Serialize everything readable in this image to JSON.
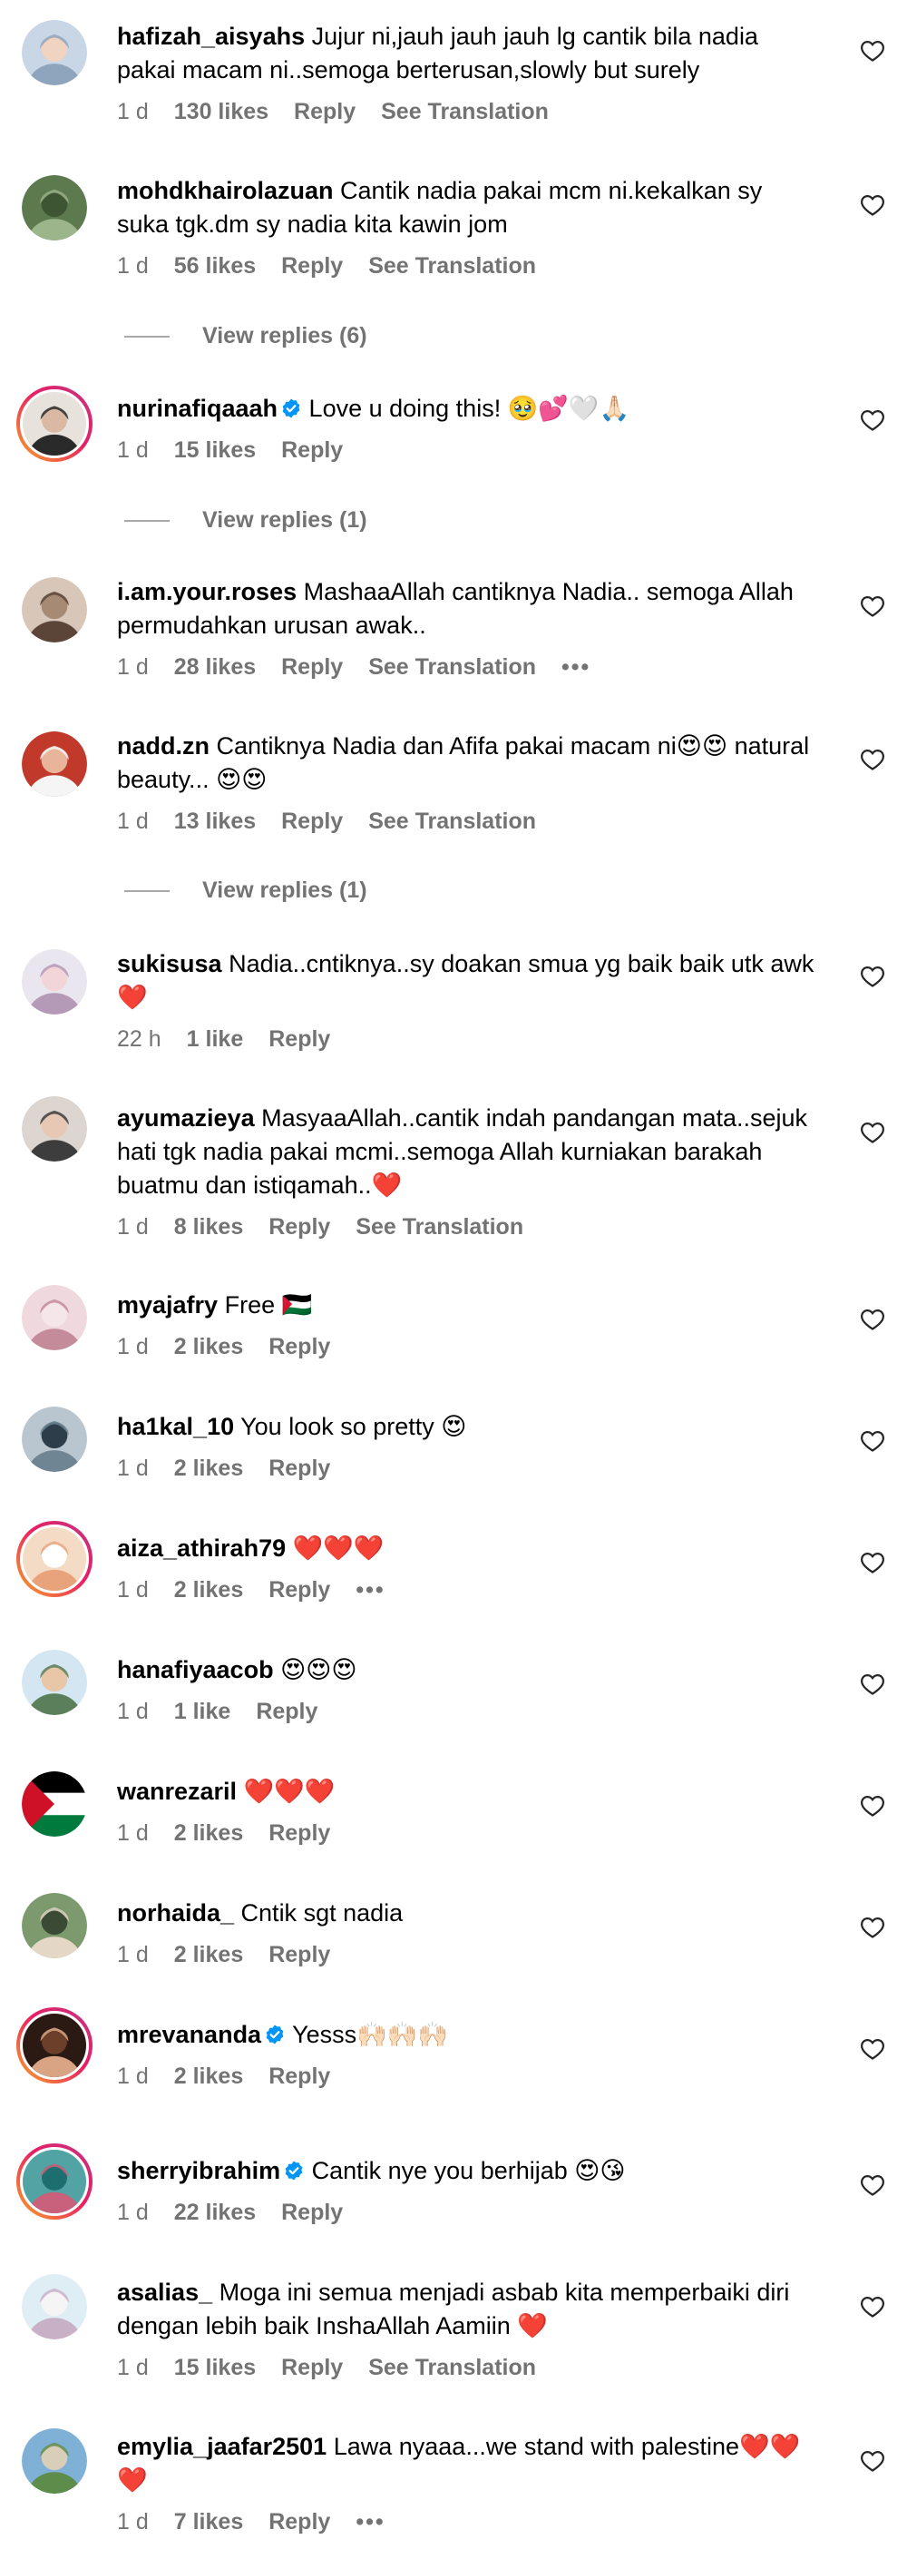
{
  "comments": [
    {
      "username": "hafizah_aisyahs",
      "verified": false,
      "text": "Jujur ni,jauh jauh jauh lg cantik bila nadia pakai macam ni..semoga berterusan,slowly but surely",
      "time": "1 d",
      "likes": "130 likes",
      "reply": "Reply",
      "translation": "See Translation",
      "more": ""
    },
    {
      "username": "mohdkhairolazuan",
      "verified": false,
      "text": "Cantik nadia pakai mcm ni.kekalkan sy suka tgk.dm sy nadia kita kawin jom",
      "time": "1 d",
      "likes": "56 likes",
      "reply": "Reply",
      "translation": "See Translation",
      "more": "",
      "view_replies": "View replies (6)"
    },
    {
      "username": "nurinafiqaaah",
      "verified": true,
      "text": "Love u doing this! 🥹💕🤍🙏🏻",
      "time": "1 d",
      "likes": "15 likes",
      "reply": "Reply",
      "translation": "",
      "more": "",
      "view_replies": "View replies (1)"
    },
    {
      "username": "i.am.your.roses",
      "verified": false,
      "text": "MashaaAllah cantiknya Nadia.. semoga Allah permudahkan urusan awak..",
      "time": "1 d",
      "likes": "28 likes",
      "reply": "Reply",
      "translation": "See Translation",
      "more": "•••"
    },
    {
      "username": "nadd.zn",
      "verified": false,
      "text": "Cantiknya Nadia dan Afifa pakai macam ni😍😍 natural beauty... 😍😍",
      "time": "1 d",
      "likes": "13 likes",
      "reply": "Reply",
      "translation": "See Translation",
      "more": "",
      "view_replies": "View replies (1)"
    },
    {
      "username": "sukisusa",
      "verified": false,
      "text": "Nadia..cntiknya..sy doakan smua yg baik baik utk awk❤️",
      "time": "22 h",
      "likes": "1 like",
      "reply": "Reply",
      "translation": "",
      "more": ""
    },
    {
      "username": "ayumazieya",
      "verified": false,
      "text": "MasyaaAllah..cantik indah pandangan mata..sejuk hati tgk nadia pakai mcmi..semoga Allah kurniakan barakah buatmu dan istiqamah..❤️",
      "time": "1 d",
      "likes": "8 likes",
      "reply": "Reply",
      "translation": "See Translation",
      "more": ""
    },
    {
      "username": "myajafry",
      "verified": false,
      "text": "Free 🇵🇸",
      "time": "1 d",
      "likes": "2 likes",
      "reply": "Reply",
      "translation": "",
      "more": ""
    },
    {
      "username": "ha1kal_10",
      "verified": false,
      "text": "You look so pretty 😍",
      "time": "1 d",
      "likes": "2 likes",
      "reply": "Reply",
      "translation": "",
      "more": ""
    },
    {
      "username": "aiza_athirah79",
      "verified": false,
      "text": "❤️❤️❤️",
      "time": "1 d",
      "likes": "2 likes",
      "reply": "Reply",
      "translation": "",
      "more": "•••"
    },
    {
      "username": "hanafiyaacob",
      "verified": false,
      "text": "😍😍😍",
      "time": "1 d",
      "likes": "1 like",
      "reply": "Reply",
      "translation": "",
      "more": ""
    },
    {
      "username": "wanrezaril",
      "verified": false,
      "text": "❤️❤️❤️",
      "time": "1 d",
      "likes": "2 likes",
      "reply": "Reply",
      "translation": "",
      "more": ""
    },
    {
      "username": "norhaida_",
      "verified": false,
      "text": "Cntik sgt nadia",
      "time": "1 d",
      "likes": "2 likes",
      "reply": "Reply",
      "translation": "",
      "more": ""
    },
    {
      "username": "mrevananda",
      "verified": true,
      "text": "Yesss🙌🏻🙌🏻🙌🏻",
      "time": "1 d",
      "likes": "2 likes",
      "reply": "Reply",
      "translation": "",
      "more": ""
    },
    {
      "username": "sherryibrahim",
      "verified": true,
      "text": "Cantik nye you berhijab 😍😘",
      "time": "1 d",
      "likes": "22 likes",
      "reply": "Reply",
      "translation": "",
      "more": ""
    },
    {
      "username": "asalias_",
      "verified": false,
      "text": "Moga ini semua menjadi asbab kita memperbaiki diri dengan lebih baik InshaAllah Aamiin ❤️",
      "time": "1 d",
      "likes": "15 likes",
      "reply": "Reply",
      "translation": "See Translation",
      "more": ""
    },
    {
      "username": "emylia_jaafar2501",
      "verified": false,
      "text": "Lawa nyaaa...we stand with palestine❤️❤️❤️",
      "time": "1 d",
      "likes": "7 likes",
      "reply": "Reply",
      "translation": "",
      "more": "•••"
    }
  ],
  "colors": {
    "secondary_text": "#737373",
    "verified_blue": "#0095f6",
    "story_ring": "#e91e63"
  },
  "icons": {
    "like": "heart-outline-icon",
    "verified": "verified-badge-icon"
  }
}
